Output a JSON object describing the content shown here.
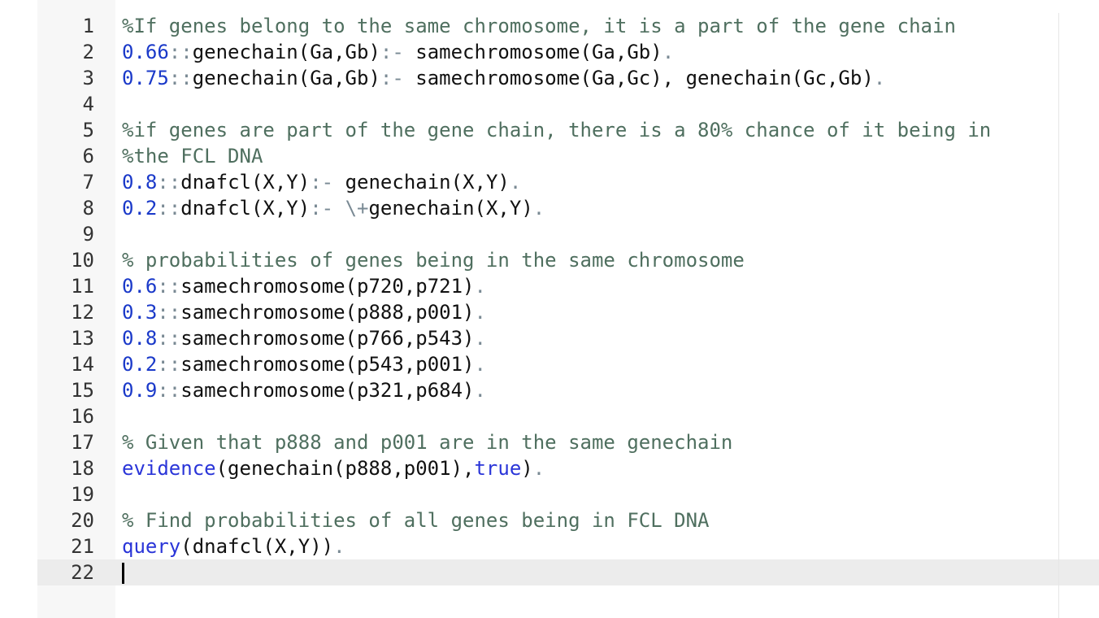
{
  "editor": {
    "lines": [
      {
        "n": "1",
        "tokens": [
          {
            "t": "comment",
            "v": "%If genes belong to the same chromosome, it is a part of the gene chain"
          }
        ]
      },
      {
        "n": "2",
        "tokens": [
          {
            "t": "number",
            "v": "0.66"
          },
          {
            "t": "op",
            "v": "::"
          },
          {
            "t": "text",
            "v": "genechain(Ga,Gb)"
          },
          {
            "t": "op",
            "v": ":-"
          },
          {
            "t": "text",
            "v": " samechromosome(Ga,Gb)"
          },
          {
            "t": "op",
            "v": "."
          }
        ]
      },
      {
        "n": "3",
        "tokens": [
          {
            "t": "number",
            "v": "0.75"
          },
          {
            "t": "op",
            "v": "::"
          },
          {
            "t": "text",
            "v": "genechain(Ga,Gb)"
          },
          {
            "t": "op",
            "v": ":-"
          },
          {
            "t": "text",
            "v": " samechromosome(Ga,Gc), genechain(Gc,Gb)"
          },
          {
            "t": "op",
            "v": "."
          }
        ]
      },
      {
        "n": "4",
        "tokens": []
      },
      {
        "n": "5",
        "tokens": [
          {
            "t": "comment",
            "v": "%if genes are part of the gene chain, there is a 80% chance of it being in"
          }
        ]
      },
      {
        "n": "6",
        "tokens": [
          {
            "t": "comment",
            "v": "%the FCL DNA"
          }
        ]
      },
      {
        "n": "7",
        "tokens": [
          {
            "t": "number",
            "v": "0.8"
          },
          {
            "t": "op",
            "v": "::"
          },
          {
            "t": "text",
            "v": "dnafcl(X,Y)"
          },
          {
            "t": "op",
            "v": ":-"
          },
          {
            "t": "text",
            "v": " genechain(X,Y)"
          },
          {
            "t": "op",
            "v": "."
          }
        ]
      },
      {
        "n": "8",
        "tokens": [
          {
            "t": "number",
            "v": "0.2"
          },
          {
            "t": "op",
            "v": "::"
          },
          {
            "t": "text",
            "v": "dnafcl(X,Y)"
          },
          {
            "t": "op",
            "v": ":-"
          },
          {
            "t": "text",
            "v": " "
          },
          {
            "t": "op",
            "v": "\\+"
          },
          {
            "t": "text",
            "v": "genechain(X,Y)"
          },
          {
            "t": "op",
            "v": "."
          }
        ]
      },
      {
        "n": "9",
        "tokens": []
      },
      {
        "n": "10",
        "tokens": [
          {
            "t": "comment",
            "v": "% probabilities of genes being in the same chromosome"
          }
        ]
      },
      {
        "n": "11",
        "tokens": [
          {
            "t": "number",
            "v": "0.6"
          },
          {
            "t": "op",
            "v": "::"
          },
          {
            "t": "text",
            "v": "samechromosome(p720,p721)"
          },
          {
            "t": "op",
            "v": "."
          }
        ]
      },
      {
        "n": "12",
        "tokens": [
          {
            "t": "number",
            "v": "0.3"
          },
          {
            "t": "op",
            "v": "::"
          },
          {
            "t": "text",
            "v": "samechromosome(p888,p001)"
          },
          {
            "t": "op",
            "v": "."
          }
        ]
      },
      {
        "n": "13",
        "tokens": [
          {
            "t": "number",
            "v": "0.8"
          },
          {
            "t": "op",
            "v": "::"
          },
          {
            "t": "text",
            "v": "samechromosome(p766,p543)"
          },
          {
            "t": "op",
            "v": "."
          }
        ]
      },
      {
        "n": "14",
        "tokens": [
          {
            "t": "number",
            "v": "0.2"
          },
          {
            "t": "op",
            "v": "::"
          },
          {
            "t": "text",
            "v": "samechromosome(p543,p001)"
          },
          {
            "t": "op",
            "v": "."
          }
        ]
      },
      {
        "n": "15",
        "tokens": [
          {
            "t": "number",
            "v": "0.9"
          },
          {
            "t": "op",
            "v": "::"
          },
          {
            "t": "text",
            "v": "samechromosome(p321,p684)"
          },
          {
            "t": "op",
            "v": "."
          }
        ]
      },
      {
        "n": "16",
        "tokens": []
      },
      {
        "n": "17",
        "tokens": [
          {
            "t": "comment",
            "v": "% Given that p888 and p001 are in the same genechain"
          }
        ]
      },
      {
        "n": "18",
        "tokens": [
          {
            "t": "keyword",
            "v": "evidence"
          },
          {
            "t": "text",
            "v": "(genechain(p888,p001),"
          },
          {
            "t": "keyword",
            "v": "true"
          },
          {
            "t": "text",
            "v": ")"
          },
          {
            "t": "op",
            "v": "."
          }
        ]
      },
      {
        "n": "19",
        "tokens": []
      },
      {
        "n": "20",
        "tokens": [
          {
            "t": "comment",
            "v": "% Find probabilities of all genes being in FCL DNA"
          }
        ]
      },
      {
        "n": "21",
        "tokens": [
          {
            "t": "keyword",
            "v": "query"
          },
          {
            "t": "text",
            "v": "(dnafcl(X,Y))"
          },
          {
            "t": "op",
            "v": "."
          }
        ]
      },
      {
        "n": "22",
        "tokens": [],
        "cursor": true
      }
    ]
  },
  "colors": {
    "comment": "#4f6f5f",
    "number": "#1a39c9",
    "keyword": "#2a35d8",
    "operator": "#7a8a94",
    "text": "#111111",
    "active_line": "#ececec",
    "gutter": "#f7f7f7"
  }
}
